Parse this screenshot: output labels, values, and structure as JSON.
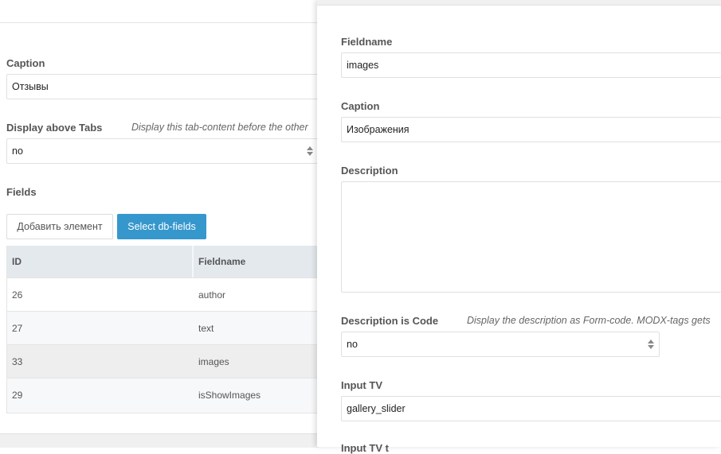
{
  "left": {
    "caption_label": "Caption",
    "caption_value": "Отзывы",
    "display_above_tabs_label": "Display above Tabs",
    "display_above_tabs_hint": "Display this tab-content before the other",
    "display_above_tabs_value": "no",
    "fields_label": "Fields",
    "add_element_label": "Добавить элемент",
    "select_db_fields_label": "Select db-fields",
    "table": {
      "headers": [
        "ID",
        "Fieldname"
      ],
      "rows": [
        {
          "id": "26",
          "fieldname": "author"
        },
        {
          "id": "27",
          "fieldname": "text"
        },
        {
          "id": "33",
          "fieldname": "images"
        },
        {
          "id": "29",
          "fieldname": "isShowImages"
        }
      ]
    }
  },
  "right": {
    "fieldname_label": "Fieldname",
    "fieldname_value": "images",
    "caption_label": "Caption",
    "caption_value": "Изображения",
    "description_label": "Description",
    "description_value": "",
    "description_is_code_label": "Description is Code",
    "description_is_code_hint": "Display the description as Form-code. MODX-tags gets",
    "description_is_code_value": "no",
    "input_tv_label": "Input TV",
    "input_tv_value": "gallery_slider",
    "next_label": "Input TV t"
  },
  "colors": {
    "primary_button": "#3697cd",
    "table_header": "#e4e9ee",
    "selected_row": "#eeeeee",
    "alt_row": "#f7f8fa"
  }
}
